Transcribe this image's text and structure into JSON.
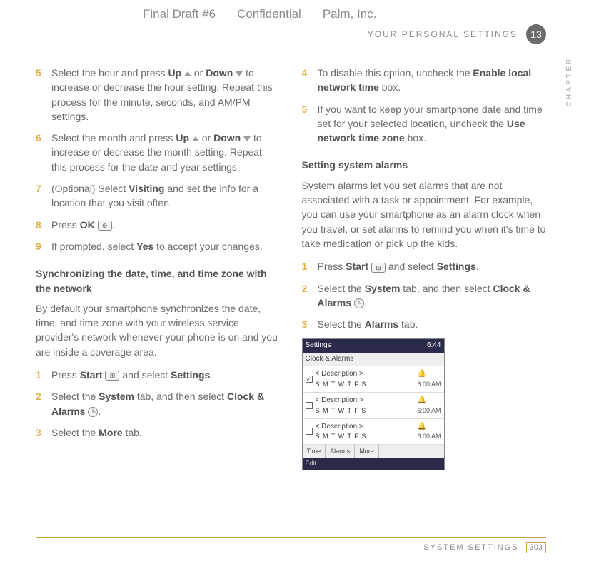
{
  "topbar": {
    "draft": "Final Draft #6",
    "conf": "Confidential",
    "company": "Palm, Inc."
  },
  "header": {
    "section": "YOUR PERSONAL SETTINGS",
    "chapter_num": "13",
    "vertical": "CHAPTER"
  },
  "left": {
    "s5": {
      "n": "5",
      "pre": "Select the hour and press ",
      "up": "Up",
      "mid1": " or ",
      "down": "Down",
      "rest": " to increase or decrease the hour setting. Repeat this process for the minute, seconds, and AM/PM settings."
    },
    "s6": {
      "n": "6",
      "pre": "Select the month and press ",
      "up": "Up",
      "mid1": " or ",
      "down": "Down",
      "rest": " to increase or decrease the month setting. Repeat this process for the date and year settings"
    },
    "s7": {
      "n": "7",
      "pre": "(Optional) Select ",
      "b": "Visiting",
      "rest": " and set the info for a location that you visit often."
    },
    "s8": {
      "n": "8",
      "pre": "Press ",
      "b": "OK",
      "rest": "."
    },
    "s9": {
      "n": "9",
      "pre": "If prompted, select ",
      "b": "Yes",
      "rest": " to accept your changes."
    },
    "sync_head": "Synchronizing the date, time, and time zone with the network",
    "sync_body": "By default your smartphone synchronizes the date, time, and time zone with your wireless service provider's network whenever your phone is on and you are inside a coverage area.",
    "l1": {
      "n": "1",
      "pre": "Press ",
      "b1": "Start",
      "mid": " and select ",
      "b2": "Settings",
      "end": "."
    },
    "l2": {
      "n": "2",
      "pre": "Select the ",
      "b1": "System",
      "mid": " tab, and then select ",
      "b2": "Clock & Alarms",
      "end": "."
    },
    "l3": {
      "n": "3",
      "pre": "Select the ",
      "b": "More",
      "end": " tab."
    }
  },
  "right": {
    "s4": {
      "n": "4",
      "pre": "To disable this option, uncheck the ",
      "b": "Enable local network time",
      "end": " box."
    },
    "s5": {
      "n": "5",
      "pre": "If you want to keep your smartphone date and time set for your selected location, uncheck the ",
      "b": "Use network time zone",
      "end": " box."
    },
    "alarms_head": "Setting system alarms",
    "alarms_body": "System alarms let you set alarms that are not associated with a task or appointment. For example, you can use your smartphone as an alarm clock when you travel, or set alarms to remind you when it's time to take medication or pick up the kids.",
    "r1": {
      "n": "1",
      "pre": "Press ",
      "b1": "Start",
      "mid": " and select ",
      "b2": "Settings",
      "end": "."
    },
    "r2": {
      "n": "2",
      "pre": "Select the ",
      "b1": "System",
      "mid": " tab, and then select ",
      "b2": "Clock & Alarms",
      "end": "."
    },
    "r3": {
      "n": "3",
      "pre": "Select the ",
      "b": "Alarms",
      "end": " tab."
    }
  },
  "screenshot": {
    "top_left": "Settings",
    "top_right": "6:44",
    "title": "Clock & Alarms",
    "row": {
      "desc": "< Description >",
      "days": "S M T W T F S",
      "time": "6:00 AM"
    },
    "tabs": [
      "Time",
      "Alarms",
      "More"
    ],
    "foot": "Edit"
  },
  "footer": {
    "label": "SYSTEM SETTINGS",
    "page": "303"
  }
}
